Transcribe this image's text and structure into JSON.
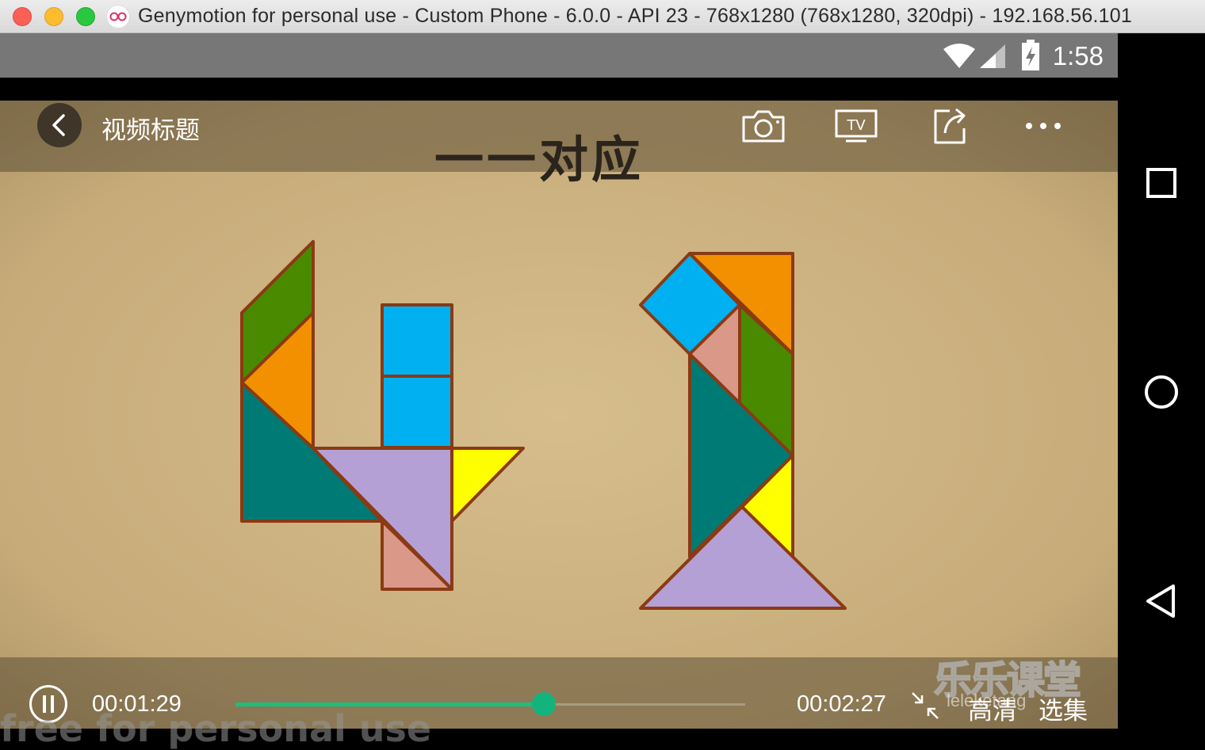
{
  "window": {
    "title": "Genymotion for personal use - Custom Phone - 6.0.0 - API 23 - 768x1280 (768x1280, 320dpi) - 192.168.56.101"
  },
  "status_bar": {
    "time": "1:58",
    "icons": [
      "wifi-icon",
      "cell-signal-icon",
      "battery-charging-icon"
    ]
  },
  "player": {
    "video_title": "视频标题",
    "lesson_heading": "一一对应",
    "top_actions": [
      "camera-icon",
      "tv-cast-icon",
      "share-icon",
      "more-icon"
    ],
    "current_time": "00:01:29",
    "total_time": "00:02:27",
    "progress_fraction": 0.6054,
    "quality_label": "高清",
    "episodes_label": "选集",
    "brand_logo_text": "乐乐课堂",
    "brand_sub_text": "leleketang"
  },
  "nav_bar": {
    "buttons": [
      "recents-icon",
      "home-icon",
      "back-triangle-icon"
    ]
  },
  "overlay": {
    "watermark": "free for personal use"
  },
  "colors": {
    "progress_accent": "#1bbf7c",
    "paper": "#cbb07e",
    "tangram_outline": "#8a3a14"
  }
}
